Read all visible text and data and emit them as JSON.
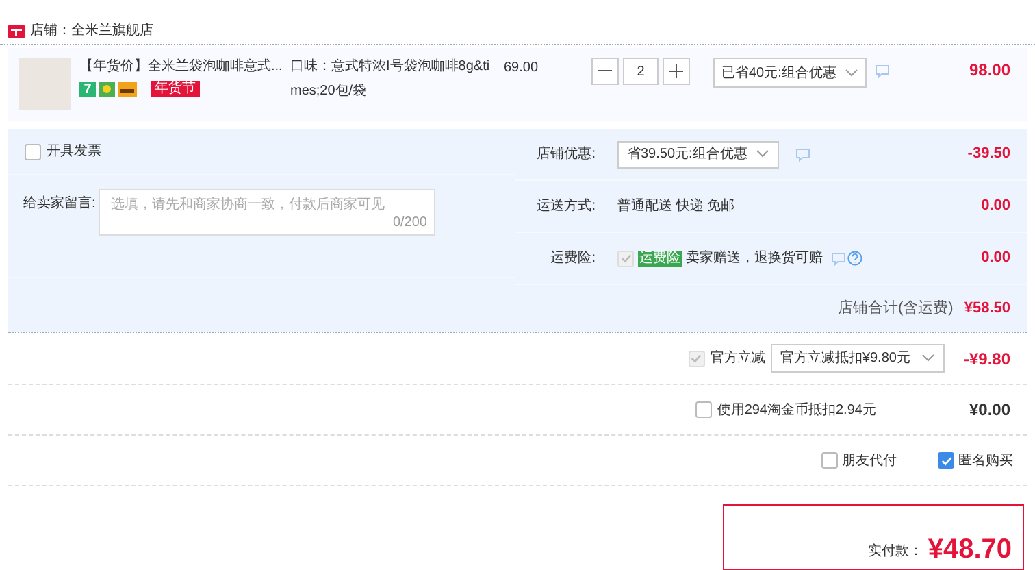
{
  "store": {
    "label": "店铺：全米兰旗舰店"
  },
  "item": {
    "title": "【年货价】全米兰袋泡咖啡意式...",
    "badge_number": "7",
    "festival_tag": "年货节",
    "spec": "口味：意式特浓I号袋泡咖啡8g&times;20包/袋",
    "unit_price": "69.00",
    "quantity": "2",
    "promo": "已省40元:组合优惠",
    "subtotal": "98.00"
  },
  "invoice": {
    "label": "开具发票",
    "checked": false
  },
  "message": {
    "label": "给卖家留言:",
    "placeholder": "选填，请先和商家协商一致，付款后商家可见",
    "counter": "0/200"
  },
  "store_rows": [
    {
      "kind": "select",
      "label": "店铺优惠:",
      "value": "省39.50元:组合优惠",
      "amount": "-39.50"
    },
    {
      "kind": "text",
      "label": "运送方式:",
      "value": "普通配送 快递 免邮",
      "amount": "0.00"
    },
    {
      "kind": "insurance",
      "label": "运费险:",
      "checked": true,
      "tag": "运费险",
      "value": "卖家赠送，退换货可赔",
      "amount": "0.00"
    }
  ],
  "store_total": {
    "label": "店铺合计(含运费)",
    "amount": "¥58.50"
  },
  "discount": {
    "label": "官方立减",
    "checked": true,
    "select": "官方立减抵扣¥9.80元",
    "amount": "-¥9.80"
  },
  "coins": {
    "label": "使用294淘金币抵扣2.94元",
    "checked": false,
    "amount": "¥0.00"
  },
  "options": [
    {
      "label": "朋友代付",
      "checked": false
    },
    {
      "label": "匿名购买",
      "checked": true
    }
  ],
  "payment": {
    "label": "实付款：",
    "amount": "¥48.70"
  }
}
